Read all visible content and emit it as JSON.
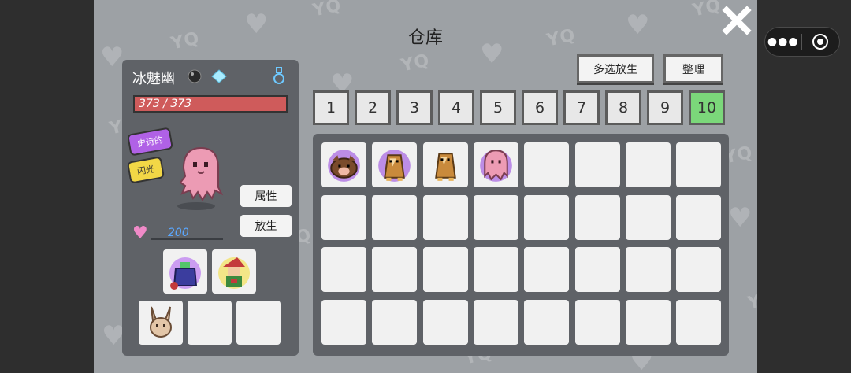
{
  "title": "仓库",
  "pet": {
    "name": "冰魅幽",
    "hp_text": "373 / 373",
    "tags": [
      "史诗的",
      "闪光"
    ],
    "affection": "200",
    "attr_label": "属性",
    "release_label": "放生"
  },
  "toolbar": {
    "multi_release_label": "多选放生",
    "sort_label": "整理"
  },
  "pages": [
    "1",
    "2",
    "3",
    "4",
    "5",
    "6",
    "7",
    "8",
    "9",
    "10"
  ],
  "active_page": "10",
  "watermark": "YQ",
  "colors": {
    "hp_bar": "#cf5b5b",
    "active_page": "#7bd77a",
    "epic_tag": "#b061e6",
    "shiny_tag": "#f2d746",
    "affection_value": "#5aa7ff"
  },
  "equipment": [
    "purple-bag-item-icon",
    "red-hat-character-icon"
  ],
  "companions": [
    "bunny-creature-icon",
    "",
    ""
  ],
  "storage": {
    "filled": [
      "pig-creature-icon",
      "owl-creature-icon-shiny",
      "owl-creature-icon",
      "pink-ghost-creature-icon"
    ],
    "total_slots": 32
  }
}
